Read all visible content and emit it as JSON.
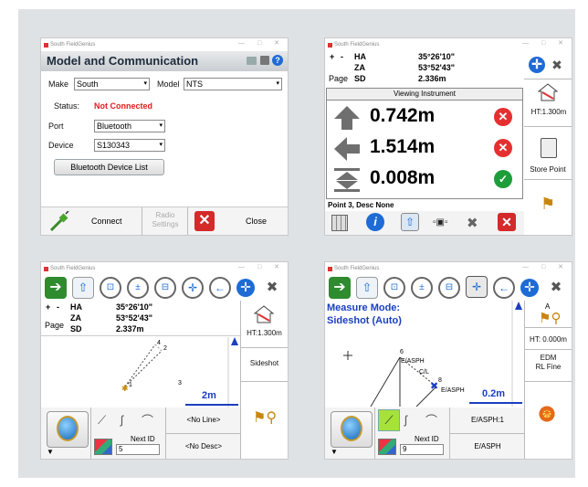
{
  "app_name": "South FieldGenius",
  "panel1": {
    "title": "Model and Communication",
    "make_label": "Make",
    "make_value": "South",
    "model_label": "Model",
    "model_value": "NTS",
    "status_label": "Status:",
    "status_value": "Not Connected",
    "port_label": "Port",
    "port_value": "Bluetooth",
    "device_label": "Device",
    "device_value": "S130343",
    "bt_list_button": "Bluetooth Device List",
    "connect": "Connect",
    "radio_settings": "Radio Settings",
    "close": "Close",
    "colors": {
      "status": "#e21b1b",
      "close_red": "#d32a2a"
    }
  },
  "panel2": {
    "plus": "+",
    "minus": "-",
    "page": "Page",
    "ha_label": "HA",
    "ha_value": "35°26'10\"",
    "za_label": "ZA",
    "za_value": "53°52'43\"",
    "sd_label": "SD",
    "sd_value": "2.336m",
    "viewing_title": "Viewing Instrument",
    "rows": [
      {
        "icon": "arrow-up-icon",
        "value": "0.742m",
        "status": "error"
      },
      {
        "icon": "arrow-left-icon",
        "value": "1.514m",
        "status": "error"
      },
      {
        "icon": "level-icon",
        "value": "0.008m",
        "status": "ok"
      }
    ],
    "ht": "HT:1.300m",
    "store_point": "Store Point",
    "point_desc": "Point 3, Desc None",
    "colors": {
      "error": "#e53030",
      "ok": "#1e9e3a"
    }
  },
  "panel3": {
    "plus": "+",
    "minus": "-",
    "page": "Page",
    "ha_label": "HA",
    "ha_value": "35°26'10\"",
    "za_label": "ZA",
    "za_value": "53°52'43\"",
    "sd_label": "SD",
    "sd_value": "2.337m",
    "ht": "HT:1.300m",
    "sideshot": "Sideshot",
    "scale": "2m",
    "points": [
      "1",
      "2",
      "3",
      "4"
    ],
    "no_line": "<No Line>",
    "no_desc": "<No Desc>",
    "next_id_label": "Next ID",
    "next_id_value": "5"
  },
  "panel4": {
    "mode_line1": "Measure Mode:",
    "mode_line2": "Sideshot (Auto)",
    "ht": "HT: 0.000m",
    "edm_line1": "EDM",
    "edm_line2": "RL Fine",
    "icon_label": "A",
    "scale": "0.2m",
    "labels": [
      "6",
      "E/ASPH",
      "C/L",
      "8",
      "E/ASPH"
    ],
    "line_code": "E/ASPH:1",
    "desc": "E/ASPH",
    "next_id_label": "Next ID",
    "next_id_value": "9",
    "colors": {
      "mode": "#1a3fbf",
      "green_button": "#a6e23a"
    }
  }
}
